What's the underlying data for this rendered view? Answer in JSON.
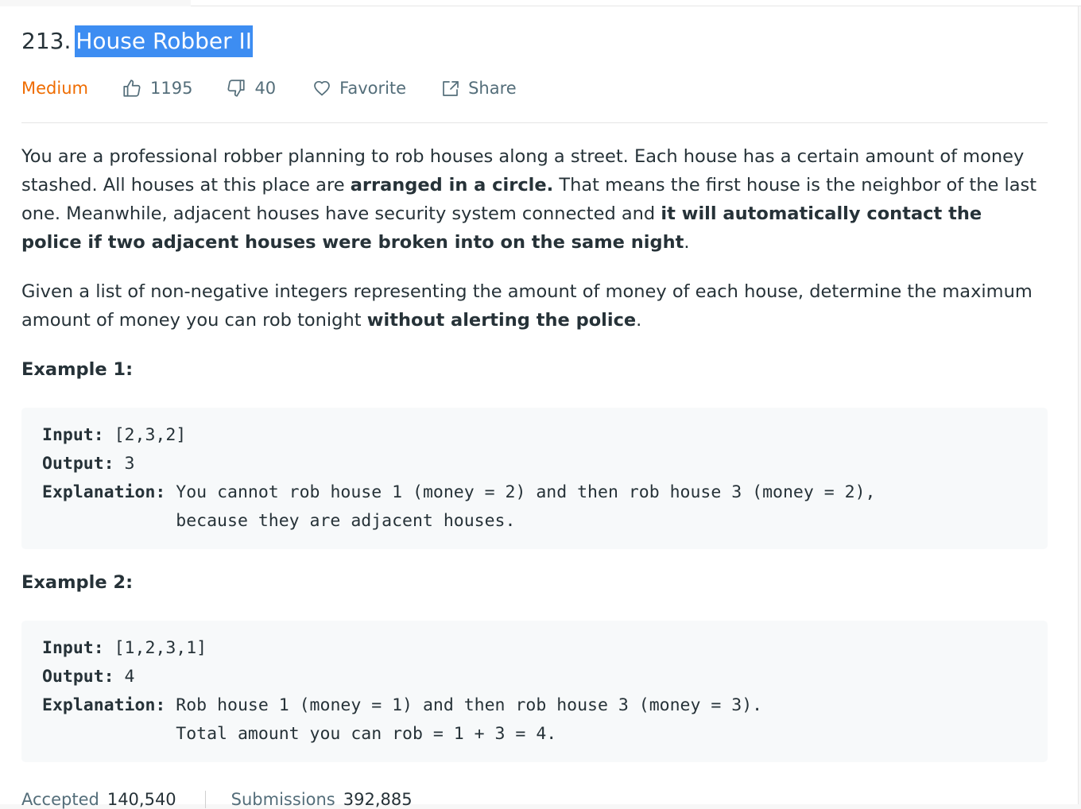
{
  "problem": {
    "number": "213.",
    "title": "House Robber II",
    "difficulty": "Medium",
    "likes": "1195",
    "dislikes": "40",
    "favorite_label": "Favorite",
    "share_label": "Share"
  },
  "description": {
    "p1": [
      {
        "text": "You are a professional robber planning to rob houses along a street. Each house has a certain amount of money stashed. All houses at this place are ",
        "bold": false
      },
      {
        "text": "arranged in a circle.",
        "bold": true
      },
      {
        "text": " That means the first house is the neighbor of the last one. Meanwhile, adjacent houses have security system connected and ",
        "bold": false
      },
      {
        "text": "it will automatically contact the police if two adjacent houses were broken into on the same night",
        "bold": true
      },
      {
        "text": ".",
        "bold": false
      }
    ],
    "p2": [
      {
        "text": "Given a list of non-negative integers representing the amount of money of each house, determine the maximum amount of money you can rob tonight ",
        "bold": false
      },
      {
        "text": "without alerting the police",
        "bold": true
      },
      {
        "text": ".",
        "bold": false
      }
    ]
  },
  "examples": [
    {
      "heading": "Example 1:",
      "input_label": "Input:",
      "input": " [2,3,2]",
      "output_label": "Output:",
      "output": " 3",
      "explanation_label": "Explanation:",
      "explanation_line1": " You cannot rob house 1 (money = 2) and then rob house 3 (money = 2),",
      "explanation_line2": "             because they are adjacent houses."
    },
    {
      "heading": "Example 2:",
      "input_label": "Input:",
      "input": " [1,2,3,1]",
      "output_label": "Output:",
      "output": " 4",
      "explanation_label": "Explanation:",
      "explanation_line1": " Rob house 1 (money = 1) and then rob house 3 (money = 3).",
      "explanation_line2": "             Total amount you can rob = 1 + 3 = 4."
    }
  ],
  "stats": {
    "accepted_label": "Accepted",
    "accepted_value": "140,540",
    "submissions_label": "Submissions",
    "submissions_value": "392,885"
  },
  "colors": {
    "difficulty": "#ef6c00",
    "title_highlight": "#3d8df2",
    "muted_text": "#546e7a",
    "code_background": "#f7f9fa"
  },
  "icons": {
    "likes": "thumbs-up-icon",
    "dislikes": "thumbs-down-icon",
    "favorite": "heart-icon",
    "share": "share-icon"
  }
}
